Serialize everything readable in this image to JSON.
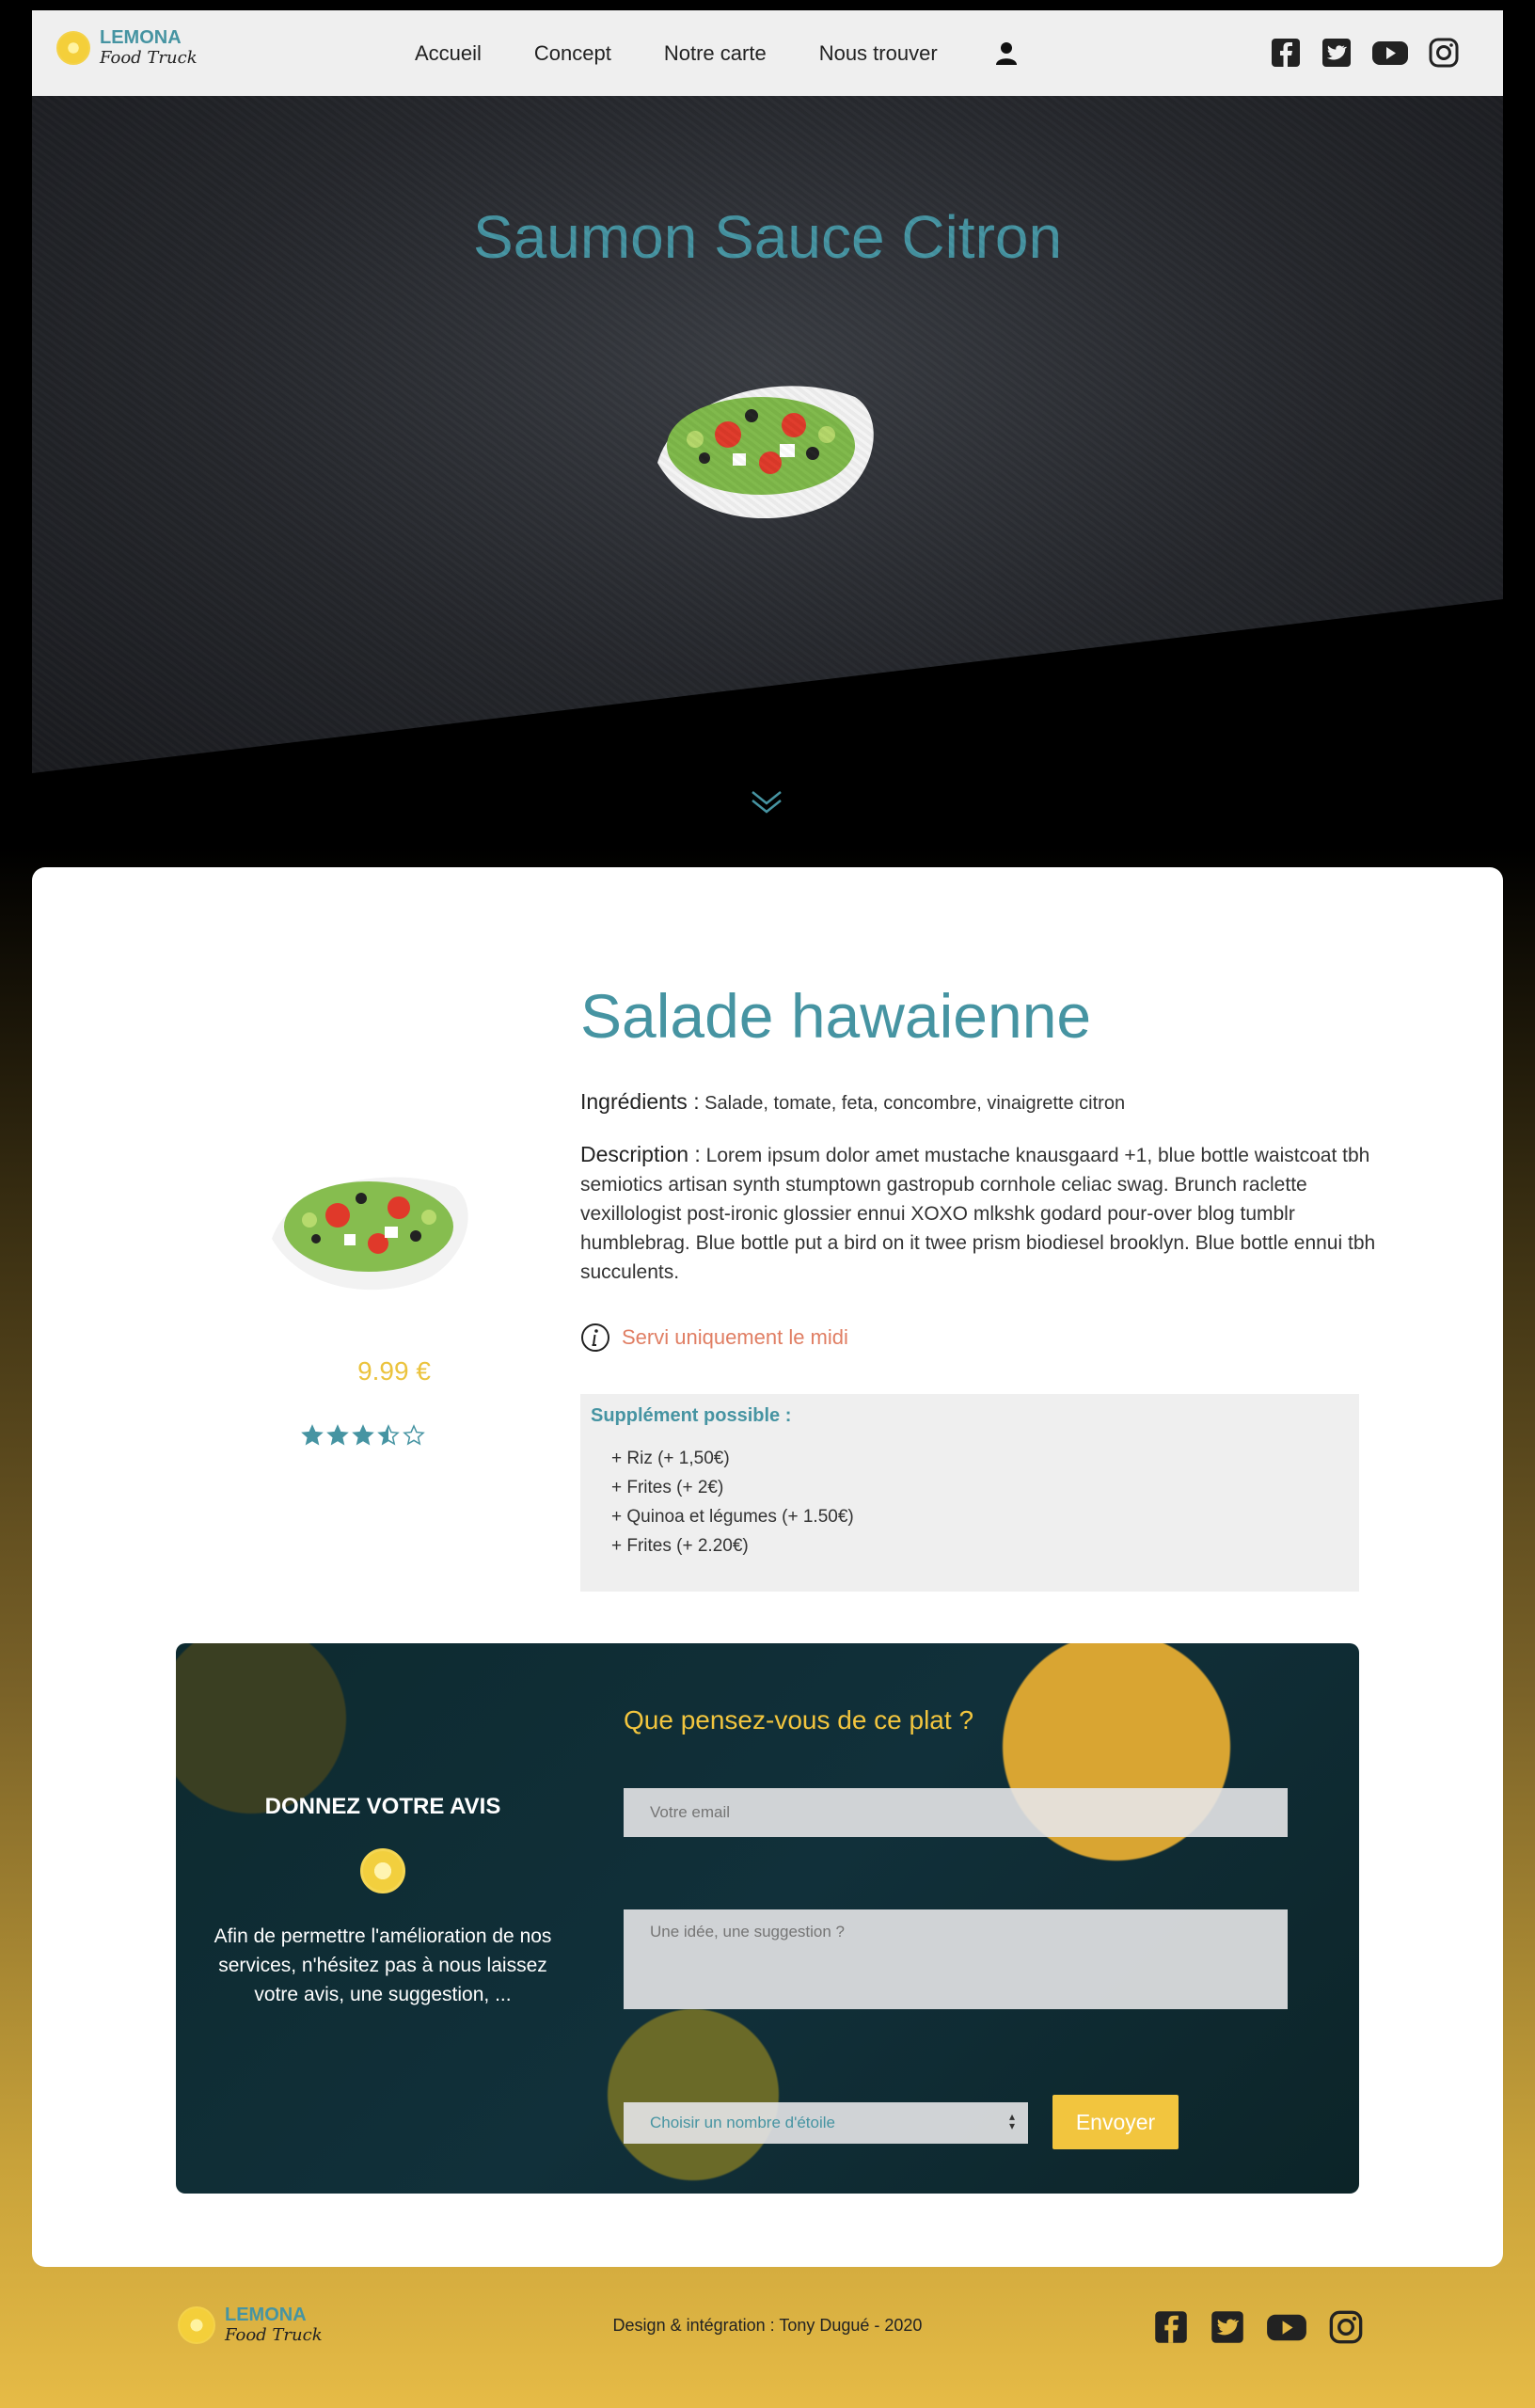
{
  "brand": {
    "name": "LEMONA",
    "tagline": "Food Truck"
  },
  "nav": {
    "items": [
      "Accueil",
      "Concept",
      "Notre carte",
      "Nous trouver"
    ]
  },
  "icons": {
    "user": "user-icon",
    "social": [
      "facebook-icon",
      "twitter-icon",
      "youtube-icon",
      "instagram-icon"
    ],
    "scroll": "chevron-down-icon",
    "info": "info-icon"
  },
  "hero": {
    "title": "Saumon Sauce Citron"
  },
  "dish": {
    "name": "Salade hawaienne",
    "price": "9.99 €",
    "rating": 3.5,
    "rating_max": 5,
    "ingredients_label": "Ingrédients :",
    "ingredients": "Salade, tomate, feta, concombre, vinaigrette citron",
    "description_label": "Description :",
    "description": "Lorem ipsum dolor amet mustache knausgaard +1, blue bottle waistcoat tbh semiotics artisan synth stumptown gastropub cornhole celiac swag. Brunch raclette vexillologist post-ironic glossier ennui XOXO mlkshk godard pour-over blog tumblr humblebrag. Blue bottle put a bird on it twee prism biodiesel brooklyn. Blue bottle ennui tbh succulents.",
    "notice": "Servi uniquement le midi",
    "supplements_title": "Supplément possible :",
    "supplements": [
      "+ Riz (+ 1,50€)",
      "+ Frites (+ 2€)",
      "+ Quinoa et légumes (+ 1.50€)",
      "+ Frites (+ 2.20€)"
    ]
  },
  "review": {
    "heading": "DONNEZ VOTRE AVIS",
    "text": "Afin de permettre l'amélioration de nos services, n'hésitez pas à nous laissez votre avis, une suggestion, ...",
    "question": "Que pensez-vous de ce plat ?",
    "email_placeholder": "Votre email",
    "idea_placeholder": "Une idée, une suggestion ?",
    "select_value": "Choisir un nombre d'étoile",
    "submit": "Envoyer"
  },
  "footer": {
    "credit": "Design & intégration : Tony Dugué - 2020"
  },
  "colors": {
    "accent": "#4694a2",
    "yellow": "#f2c53e",
    "notice": "#e07e63"
  }
}
